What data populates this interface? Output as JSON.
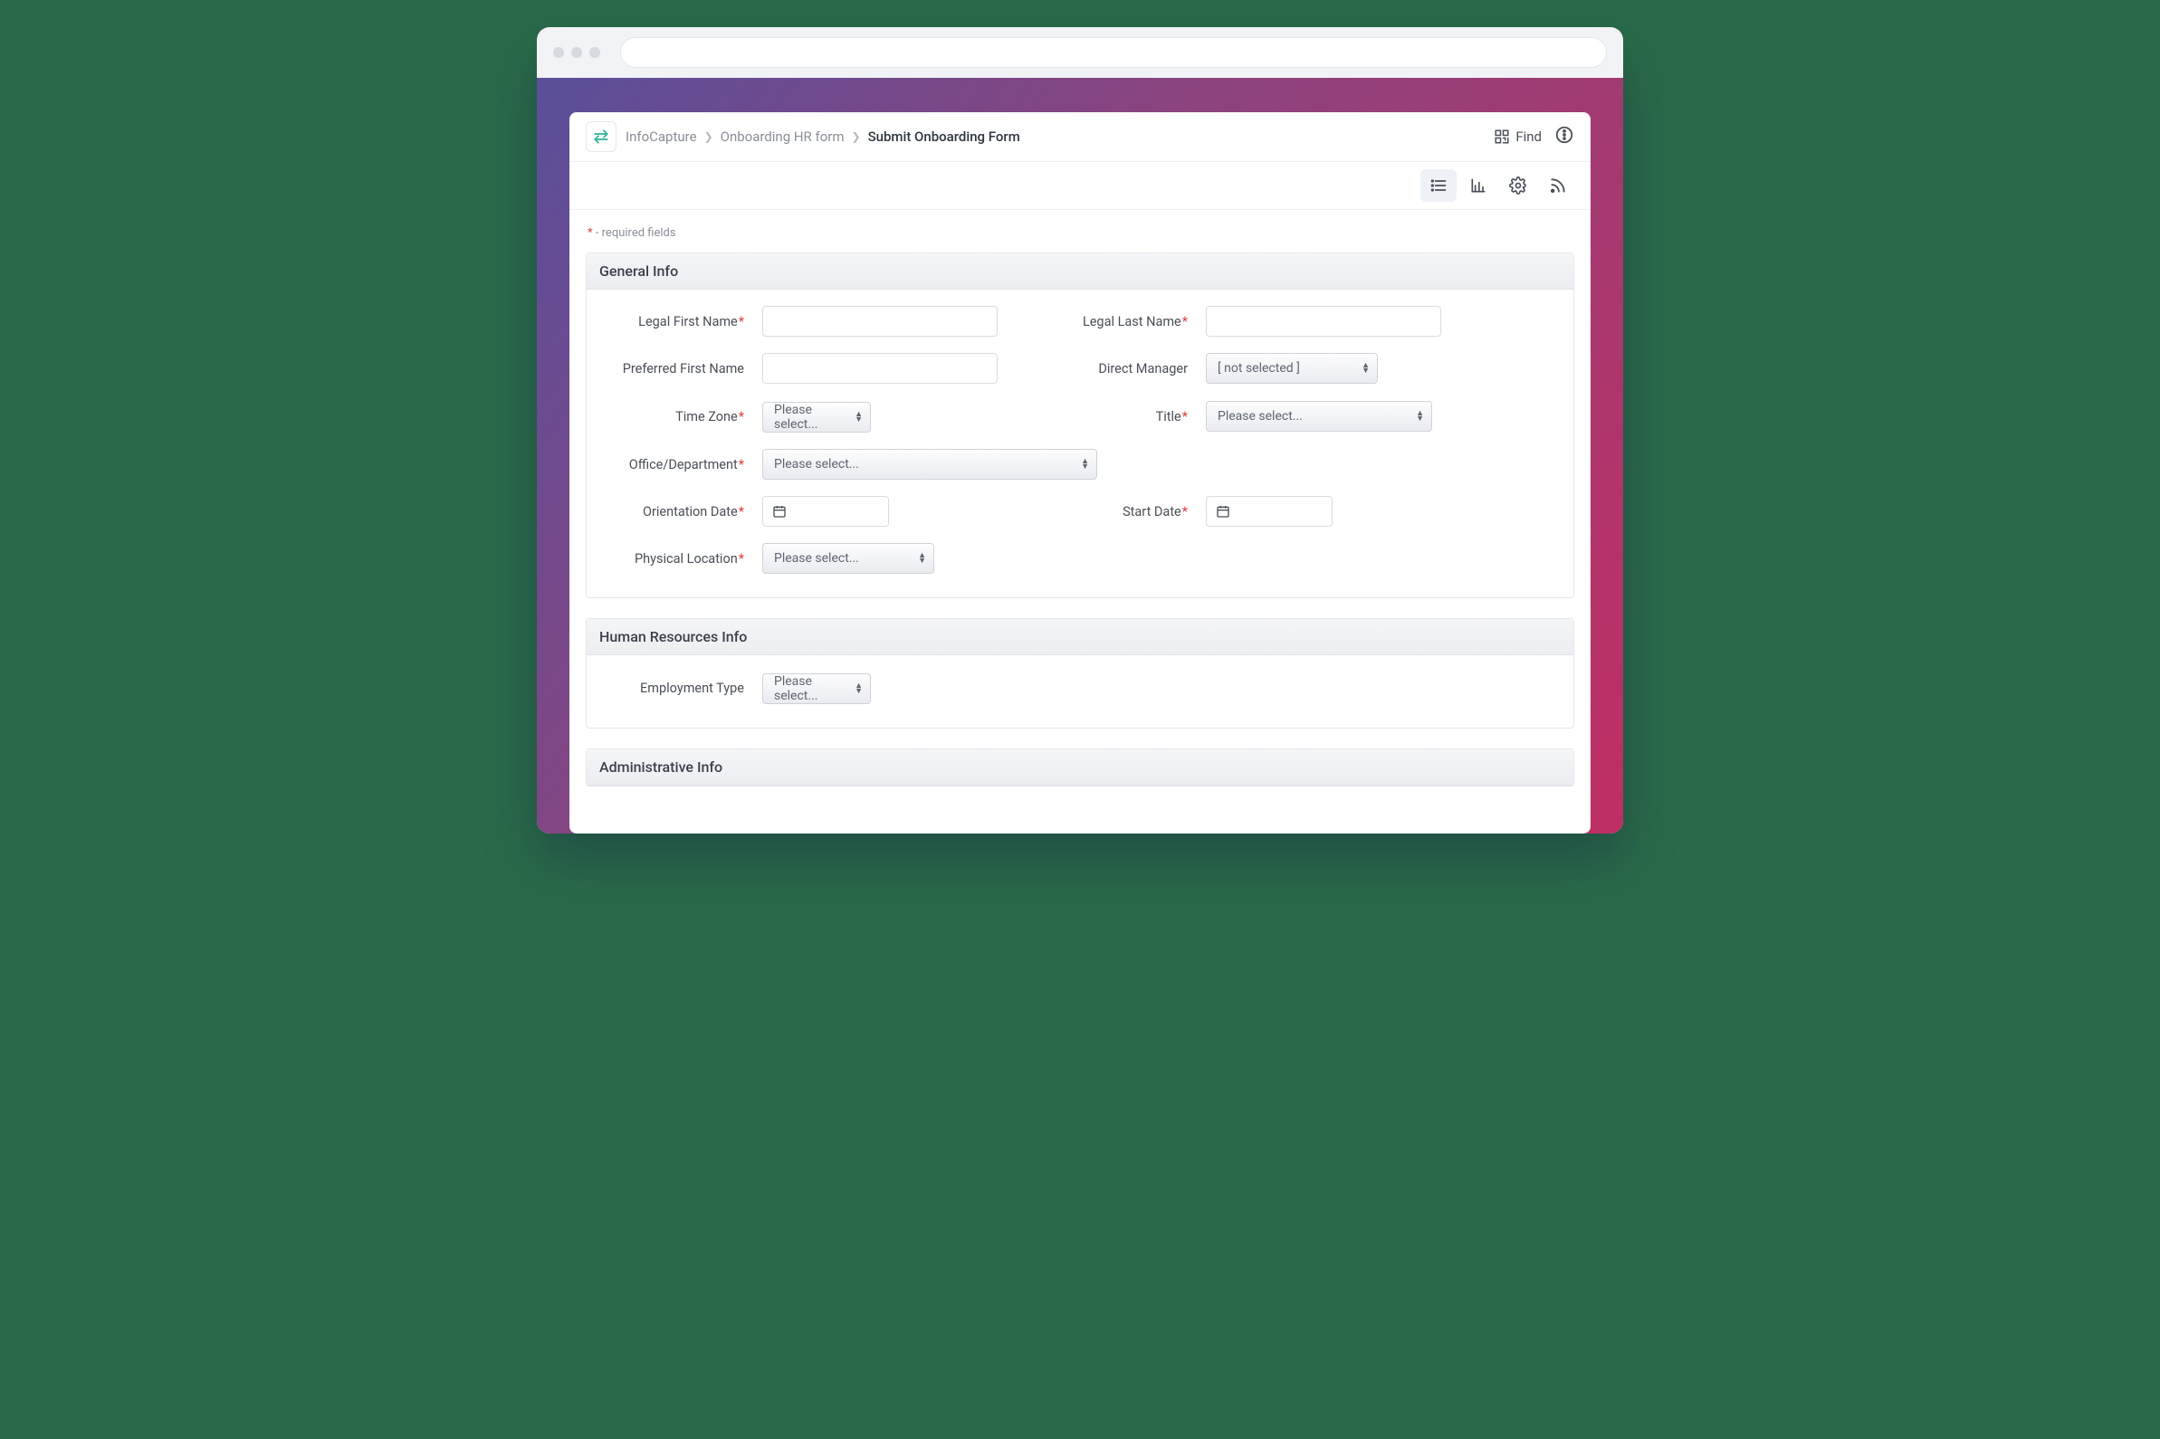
{
  "breadcrumb": {
    "items": [
      "InfoCapture",
      "Onboarding HR form"
    ],
    "current": "Submit Onboarding Form"
  },
  "topbar": {
    "find_label": "Find"
  },
  "required_note": {
    "star": "*",
    "text": " - required fields"
  },
  "sections": {
    "general": {
      "title": "General Info",
      "fields": {
        "legal_first_name": {
          "label": "Legal First Name",
          "required": true
        },
        "legal_last_name": {
          "label": "Legal Last Name",
          "required": true
        },
        "preferred_first_name": {
          "label": "Preferred First Name",
          "required": false
        },
        "direct_manager": {
          "label": "Direct Manager",
          "required": false,
          "value": "[ not selected ]"
        },
        "time_zone": {
          "label": "Time Zone",
          "required": true,
          "value": "Please select..."
        },
        "title": {
          "label": "Title",
          "required": true,
          "value": "Please select..."
        },
        "office_department": {
          "label": "Office/Department",
          "required": true,
          "value": "Please select..."
        },
        "orientation_date": {
          "label": "Orientation Date",
          "required": true
        },
        "start_date": {
          "label": "Start Date",
          "required": true
        },
        "physical_location": {
          "label": "Physical Location",
          "required": true,
          "value": "Please select..."
        }
      }
    },
    "hr": {
      "title": "Human Resources Info",
      "fields": {
        "employment_type": {
          "label": "Employment Type",
          "required": false,
          "value": "Please select..."
        }
      }
    },
    "admin": {
      "title": "Administrative Info"
    }
  }
}
